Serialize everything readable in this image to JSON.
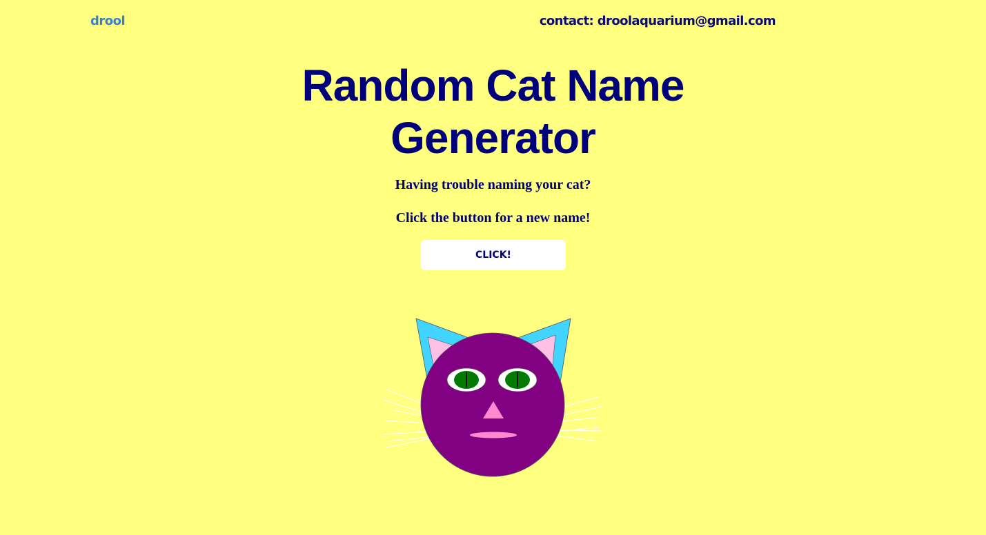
{
  "nav": {
    "brand": "drool",
    "contact": "contact: droolaquarium@gmail.com"
  },
  "main": {
    "title": "Random Cat Name Generator",
    "subtitle": "Having trouble naming your cat?",
    "instruction": "Click the button for a new name!",
    "button_label": "CLICK!"
  },
  "colors": {
    "background": "#ffff80",
    "text": "#00007a",
    "brand": "#3a7fd0",
    "cat_face": "#820082",
    "cat_ears": "#40d4ff",
    "cat_inner_ear": "#ffc0e8",
    "cat_eye_iris": "#007a00",
    "cat_nose": "#ff8ad0"
  },
  "illustration": {
    "name": "cat-face-illustration"
  }
}
